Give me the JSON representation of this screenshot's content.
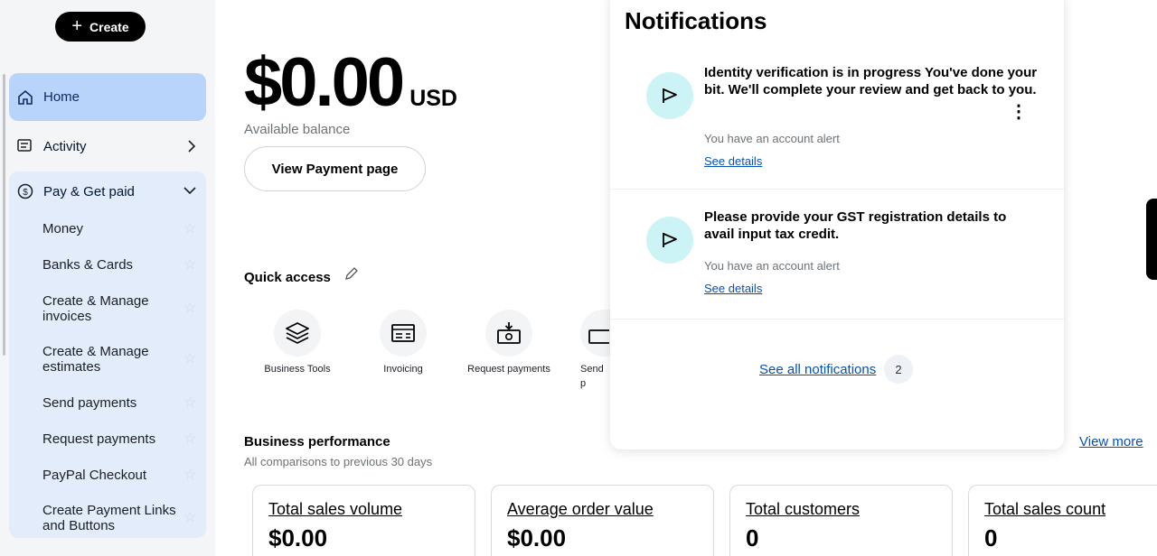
{
  "sidebar": {
    "create_label": "Create",
    "home": "Home",
    "activity": "Activity",
    "pay_group": "Pay & Get paid",
    "sub_items": [
      "Money",
      "Banks & Cards",
      "Create & Manage invoices",
      "Create & Manage estimates",
      "Send payments",
      "Request payments",
      "PayPal Checkout",
      "Create Payment Links and Buttons"
    ]
  },
  "balance": {
    "amount": "$0.00",
    "currency": "USD",
    "label": "Available balance",
    "button": "View Payment page"
  },
  "quick_access": {
    "title": "Quick access",
    "items": [
      {
        "label": "Business Tools",
        "icon": "layers-icon"
      },
      {
        "label": "Invoicing",
        "icon": "invoice-icon"
      },
      {
        "label": "Request payments",
        "icon": "request-money-icon"
      },
      {
        "label": "Send p",
        "icon": "send-money-icon"
      }
    ]
  },
  "business_performance": {
    "title": "Business performance",
    "subtitle": "All comparisons to previous 30 days",
    "view_more": "View more",
    "kpis": [
      {
        "title": "Total sales volume",
        "value": "$0.00"
      },
      {
        "title": "Average order value",
        "value": "$0.00"
      },
      {
        "title": "Total customers",
        "value": "0"
      },
      {
        "title": "Total sales count",
        "value": "0"
      }
    ]
  },
  "notifications": {
    "title": "Notifications",
    "items": [
      {
        "text": "Identity verification is in progress You've done your bit. We'll complete your review and get back to you.",
        "alert": "You have an account alert",
        "link": "See details"
      },
      {
        "text": "Please provide your GST registration details to avail input tax credit.",
        "alert": "You have an account alert",
        "link": "See details"
      }
    ],
    "see_all": "See all notifications",
    "count": "2"
  },
  "colors": {
    "accent_blue": "#0551b5",
    "home_active": "#b9d4fa",
    "flag_bg": "#ccf3f5"
  }
}
